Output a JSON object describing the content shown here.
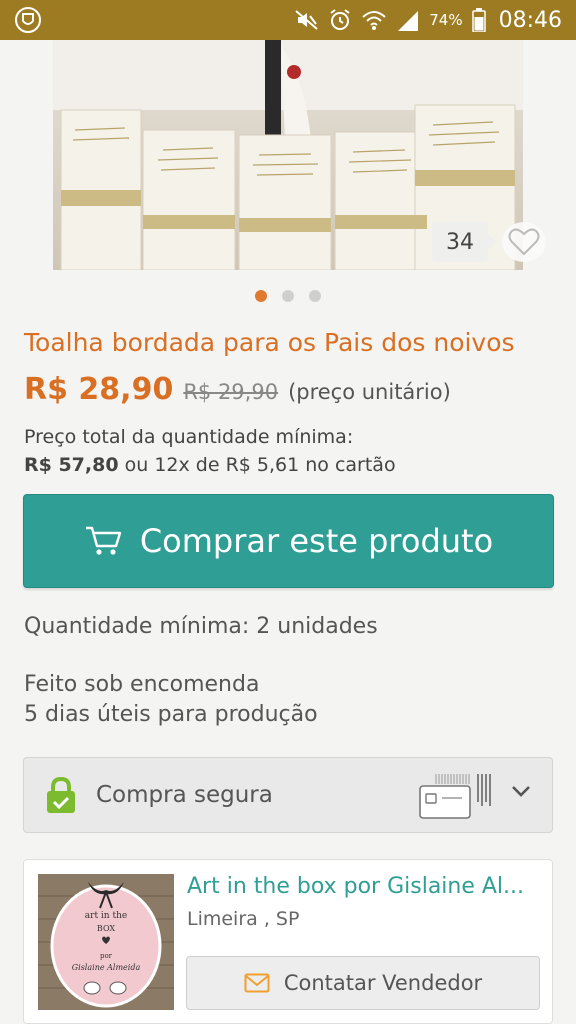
{
  "status_bar": {
    "battery_percent": "74%",
    "time": "08:46"
  },
  "product": {
    "likes": "34",
    "gallery_pages": 3,
    "gallery_active": 1,
    "title": "Toalha bordada para os Pais dos noivos",
    "price": "R$ 28,90",
    "old_price": "R$ 29,90",
    "unit_note": "(preço unitário)",
    "total_label": "Preço total da quantidade mínima:",
    "total_price": "R$ 57,80",
    "installments": "ou 12x de R$ 5,61 no cartão",
    "buy_button": "Comprar este produto",
    "min_quantity": "Quantidade mínima: 2 unidades",
    "made_to_order": "Feito sob encomenda",
    "production_time": "5 dias úteis para produção"
  },
  "secure": {
    "label": "Compra segura"
  },
  "seller": {
    "name": "Art in the box por Gislaine Al...",
    "location": "Limeira , SP",
    "contact_button": "Contatar Vendedor",
    "logo_text": {
      "line1": "art in the",
      "line2": "BOX",
      "line3": "por",
      "line4": "Gislaine Almeida"
    }
  },
  "colors": {
    "status_bar": "#9c7b22",
    "accent_orange": "#d96f22",
    "teal": "#2f9e95",
    "lock_green": "#7dbb2e",
    "mail_orange": "#f0a030"
  }
}
